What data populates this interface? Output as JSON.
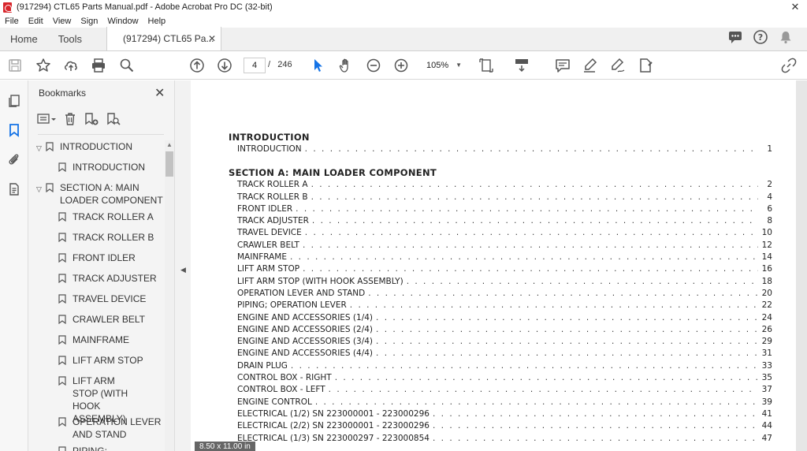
{
  "window": {
    "title": "(917294) CTL65 Parts Manual.pdf - Adobe Acrobat Pro DC (32-bit)",
    "close": "✕"
  },
  "menu": [
    "File",
    "Edit",
    "View",
    "Sign",
    "Window",
    "Help"
  ],
  "tabs": {
    "home": "Home",
    "tools": "Tools",
    "document": "(917294) CTL65 Pa...",
    "close": "✕"
  },
  "toolbar": {
    "page_current": "4",
    "page_separator": "/",
    "page_total": "246",
    "zoom": "105%",
    "zoom_dropdown": "▼"
  },
  "panel": {
    "title": "Bookmarks",
    "close": "✕",
    "items": [
      {
        "label": "INTRODUCTION",
        "level": 0,
        "expanded": true
      },
      {
        "label": "INTRODUCTION",
        "level": 1
      },
      {
        "label": "SECTION A: MAIN LOADER COMPONENT",
        "level": 0,
        "expanded": true
      },
      {
        "label": "TRACK ROLLER A",
        "level": 1
      },
      {
        "label": "TRACK ROLLER B",
        "level": 1
      },
      {
        "label": "FRONT IDLER",
        "level": 1
      },
      {
        "label": "TRACK ADJUSTER",
        "level": 1
      },
      {
        "label": "TRAVEL DEVICE",
        "level": 1
      },
      {
        "label": "CRAWLER BELT",
        "level": 1
      },
      {
        "label": "MAINFRAME",
        "level": 1
      },
      {
        "label": "LIFT ARM STOP",
        "level": 1
      },
      {
        "label": "LIFT ARM STOP (WITH HOOK ASSEMBLY)",
        "level": 1
      },
      {
        "label": "OPERATION LEVER AND STAND",
        "level": 1
      },
      {
        "label": "PIPING; OPERATION",
        "level": 1
      }
    ]
  },
  "document": {
    "page_size": "8.50 x 11.00 in",
    "sections": [
      {
        "heading": "INTRODUCTION",
        "entries": [
          {
            "title": "INTRODUCTION",
            "page": "1"
          }
        ]
      },
      {
        "heading": "SECTION A: MAIN LOADER COMPONENT",
        "entries": [
          {
            "title": "TRACK ROLLER A",
            "page": "2"
          },
          {
            "title": "TRACK ROLLER B",
            "page": "4"
          },
          {
            "title": "FRONT IDLER",
            "page": "6"
          },
          {
            "title": "TRACK ADJUSTER",
            "page": "8"
          },
          {
            "title": "TRAVEL DEVICE",
            "page": "10"
          },
          {
            "title": "CRAWLER BELT",
            "page": "12"
          },
          {
            "title": "MAINFRAME",
            "page": "14"
          },
          {
            "title": "LIFT ARM STOP",
            "page": "16"
          },
          {
            "title": "LIFT ARM STOP (WITH HOOK ASSEMBLY)",
            "page": "18"
          },
          {
            "title": "OPERATION LEVER AND STAND",
            "page": "20"
          },
          {
            "title": "PIPING; OPERATION LEVER",
            "page": "22"
          },
          {
            "title": "ENGINE AND ACCESSORIES (1/4)",
            "page": "24"
          },
          {
            "title": "ENGINE AND ACCESSORIES (2/4)",
            "page": "26"
          },
          {
            "title": "ENGINE AND ACCESSORIES (3/4)",
            "page": "29"
          },
          {
            "title": "ENGINE AND ACCESSORIES (4/4)",
            "page": "31"
          },
          {
            "title": "DRAIN PLUG",
            "page": "33"
          },
          {
            "title": "CONTROL BOX - RIGHT",
            "page": "35"
          },
          {
            "title": "CONTROL BOX - LEFT",
            "page": "37"
          },
          {
            "title": "ENGINE CONTROL",
            "page": "39"
          },
          {
            "title": "ELECTRICAL (1/2) SN 223000001 - 223000296",
            "page": "41"
          },
          {
            "title": "ELECTRICAL (2/2) SN 223000001 - 223000296",
            "page": "44"
          },
          {
            "title": "ELECTRICAL (1/3) SN 223000297 - 223000854",
            "page": "47"
          }
        ]
      }
    ]
  },
  "colors": {
    "accent_blue": "#1473e6",
    "app_red": "#d8262c",
    "icon_gray": "#555555"
  }
}
